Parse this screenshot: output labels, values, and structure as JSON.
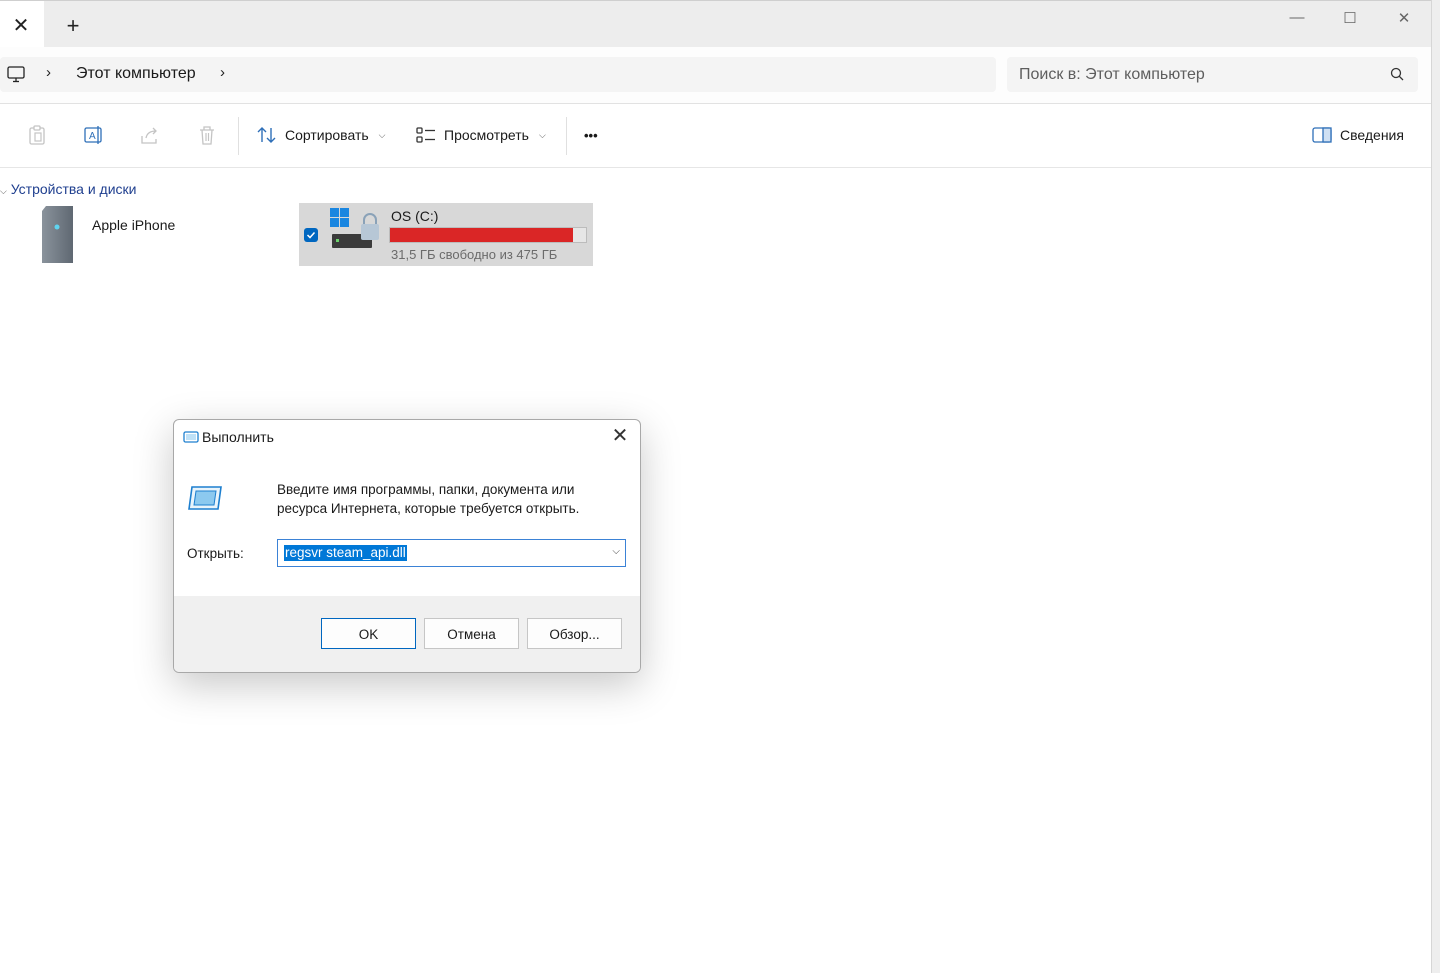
{
  "window": {
    "tab_close_glyph": "✕",
    "new_tab_glyph": "+",
    "minimize_glyph": "—",
    "maximize_glyph": "☐",
    "close_glyph": "✕"
  },
  "address": {
    "breadcrumb": "Этот компьютер",
    "search_placeholder": "Поиск в: Этот компьютер"
  },
  "toolbar": {
    "sort_label": "Сортировать",
    "view_label": "Просмотреть",
    "more_label": "•••",
    "details_label": "Сведения"
  },
  "content": {
    "section_label": "Устройства и диски",
    "devices": [
      {
        "name": "Apple iPhone"
      },
      {
        "name": "OS (C:)",
        "free_text": "31,5 ГБ свободно из 475 ГБ",
        "used_fraction": 0.934
      }
    ]
  },
  "run_dialog": {
    "title": "Выполнить",
    "description": "Введите имя программы, папки, документа или ресурса Интернета, которые требуется открыть.",
    "open_label": "Открыть:",
    "open_value": "regsvr steam_api.dll",
    "ok_label": "OK",
    "cancel_label": "Отмена",
    "browse_label": "Обзор..."
  },
  "colors": {
    "accent": "#0067c0",
    "drive_bar_fill": "#da2626",
    "selection": "#0078d7"
  }
}
